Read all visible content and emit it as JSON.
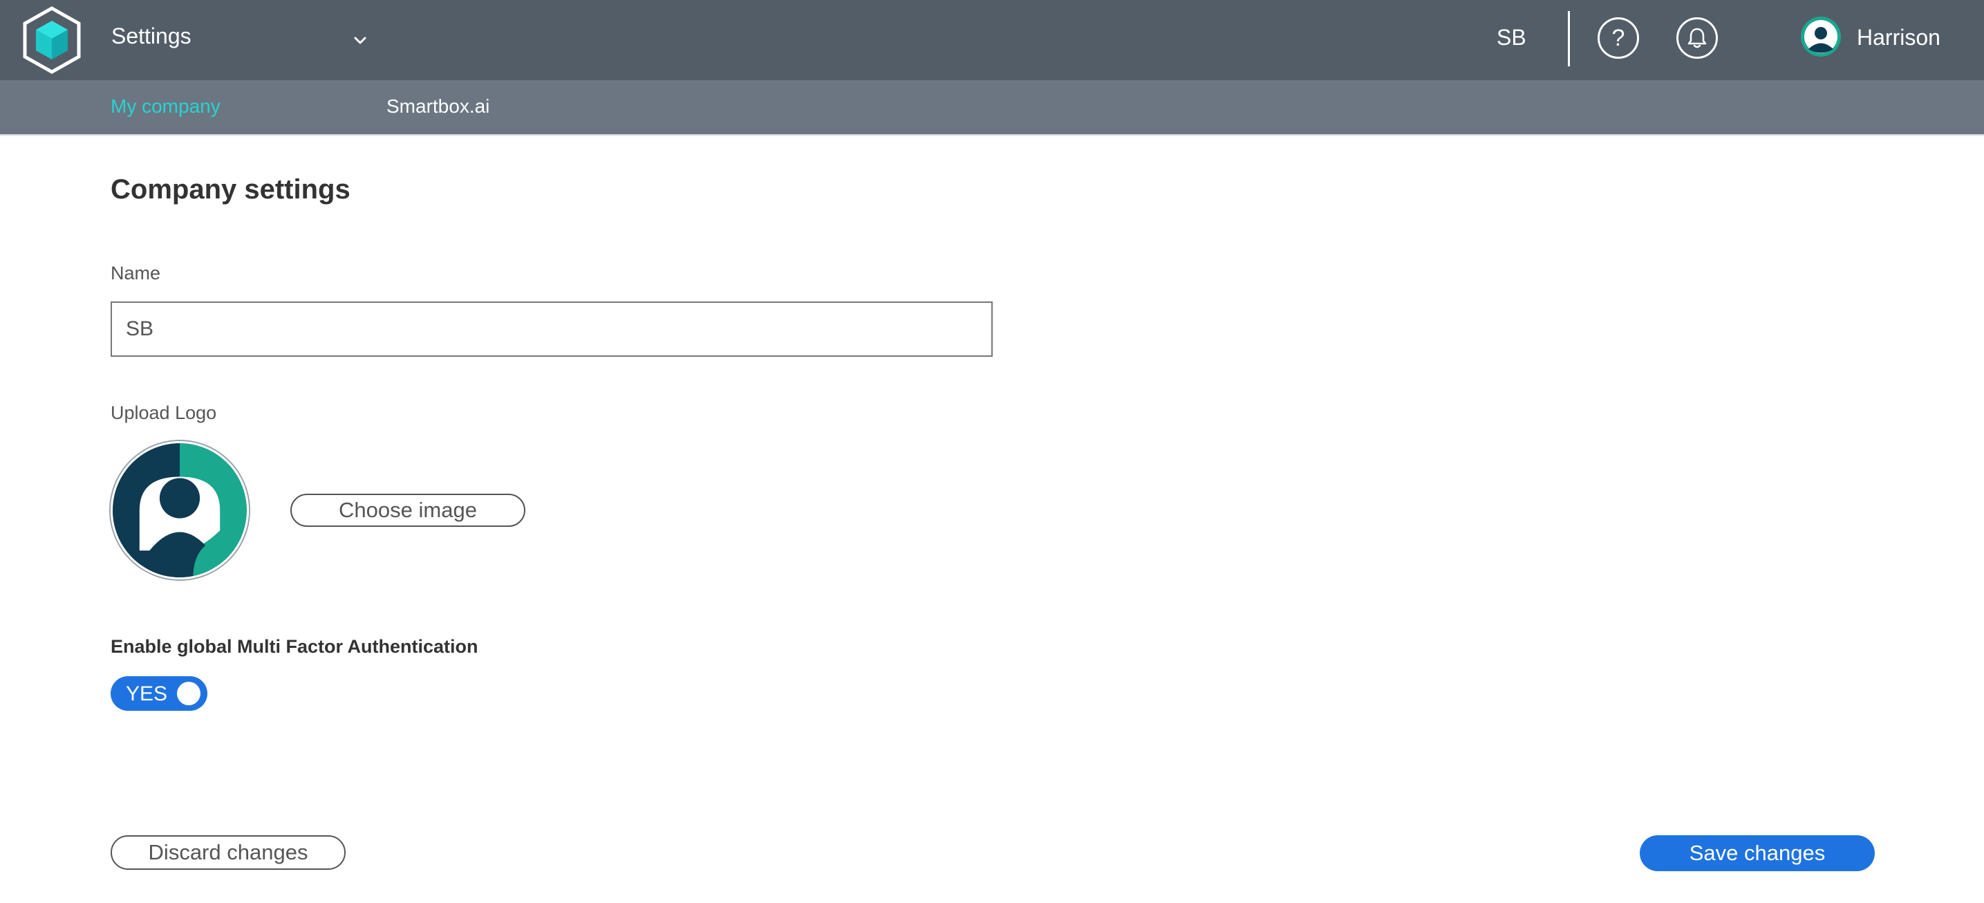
{
  "header": {
    "app_title": "Settings",
    "company_code": "SB",
    "user_name": "Harrison",
    "help_symbol": "?",
    "icons": [
      "app-logo-icon",
      "chevron-down-icon",
      "help-icon",
      "bell-icon",
      "user-avatar-icon"
    ]
  },
  "subnav": {
    "items": [
      {
        "label": "My company",
        "active": true
      },
      {
        "label": "Smartbox.ai",
        "active": false
      }
    ]
  },
  "form": {
    "title": "Company settings",
    "name_label": "Name",
    "name_value": "SB",
    "upload_logo_label": "Upload Logo",
    "choose_image_label": "Choose image",
    "mfa_label": "Enable global Multi Factor Authentication",
    "mfa_toggle_text": "YES",
    "mfa_enabled": true
  },
  "actions": {
    "discard_label": "Discard changes",
    "save_label": "Save changes"
  },
  "colors": {
    "topbar": "#535d68",
    "subnav": "#6b7682",
    "active_tab": "#27d3d3",
    "primary_blue": "#1f73e0",
    "avatar_teal": "#1aa88f",
    "avatar_navy": "#0e3a52"
  }
}
